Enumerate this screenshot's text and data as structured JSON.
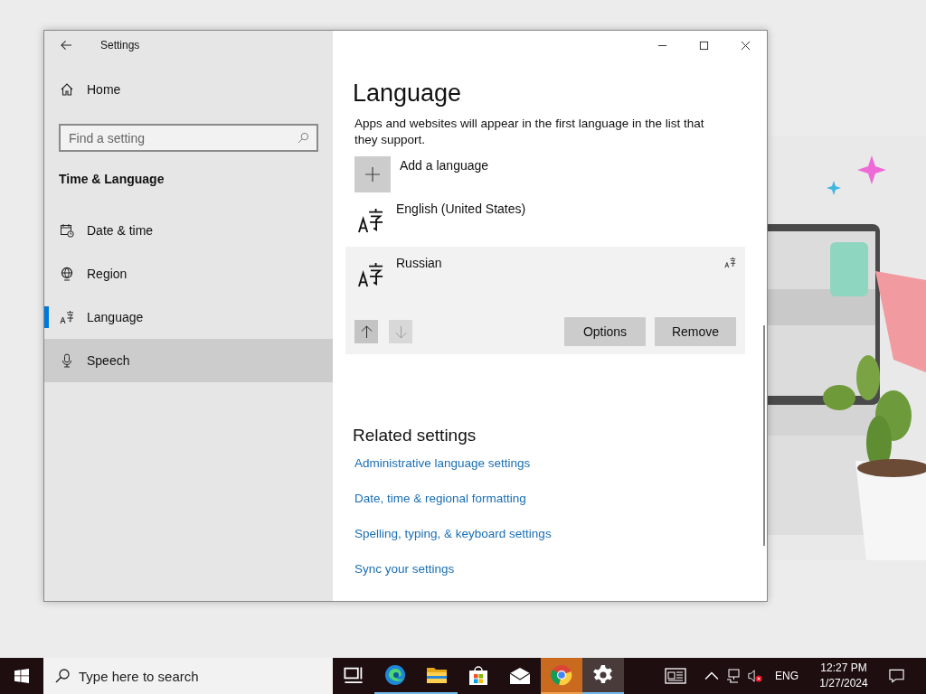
{
  "window": {
    "title": "Settings"
  },
  "sidebar": {
    "home": "Home",
    "search": {
      "placeholder": "Find a setting"
    },
    "section": "Time & Language",
    "items": [
      {
        "kind": "calendar",
        "label": "Date & time",
        "selected": false,
        "hovered": false
      },
      {
        "kind": "globe",
        "label": "Region",
        "selected": false,
        "hovered": false
      },
      {
        "kind": "language",
        "label": "Language",
        "selected": true,
        "hovered": false
      },
      {
        "kind": "microphone",
        "label": "Speech",
        "selected": false,
        "hovered": true
      }
    ]
  },
  "content": {
    "title": "Language",
    "description": "Apps and websites will appear in the first language in the list that they support.",
    "add_label": "Add a language",
    "languages": [
      {
        "name": "English (United States)",
        "selected": false,
        "feature_icon": false
      },
      {
        "name": "Russian",
        "selected": true,
        "feature_icon": true
      }
    ],
    "move_buttons": [
      {
        "kind": "up",
        "disabled": false
      },
      {
        "kind": "down",
        "disabled": true
      }
    ],
    "actions": [
      "Options",
      "Remove"
    ],
    "related_title": "Related settings",
    "related_links": [
      "Administrative language settings",
      "Date, time & regional formatting",
      "Spelling, typing, & keyboard settings",
      "Sync your settings"
    ]
  },
  "taskbar": {
    "search": {
      "placeholder": "Type here to search"
    },
    "apps": [
      {
        "kind": "task-view",
        "running": false,
        "flashing": false,
        "active": false
      },
      {
        "kind": "edge",
        "running": true,
        "flashing": false,
        "active": false
      },
      {
        "kind": "explorer",
        "running": true,
        "flashing": false,
        "active": false
      },
      {
        "kind": "store",
        "running": false,
        "flashing": false,
        "active": false
      },
      {
        "kind": "mail",
        "running": false,
        "flashing": false,
        "active": false
      },
      {
        "kind": "chrome",
        "running": true,
        "flashing": true,
        "active": false
      },
      {
        "kind": "settings",
        "running": true,
        "flashing": false,
        "active": true
      }
    ],
    "tray": {
      "language": "ENG",
      "time": "12:27 PM",
      "date": "1/27/2024",
      "volume_muted": true
    }
  }
}
